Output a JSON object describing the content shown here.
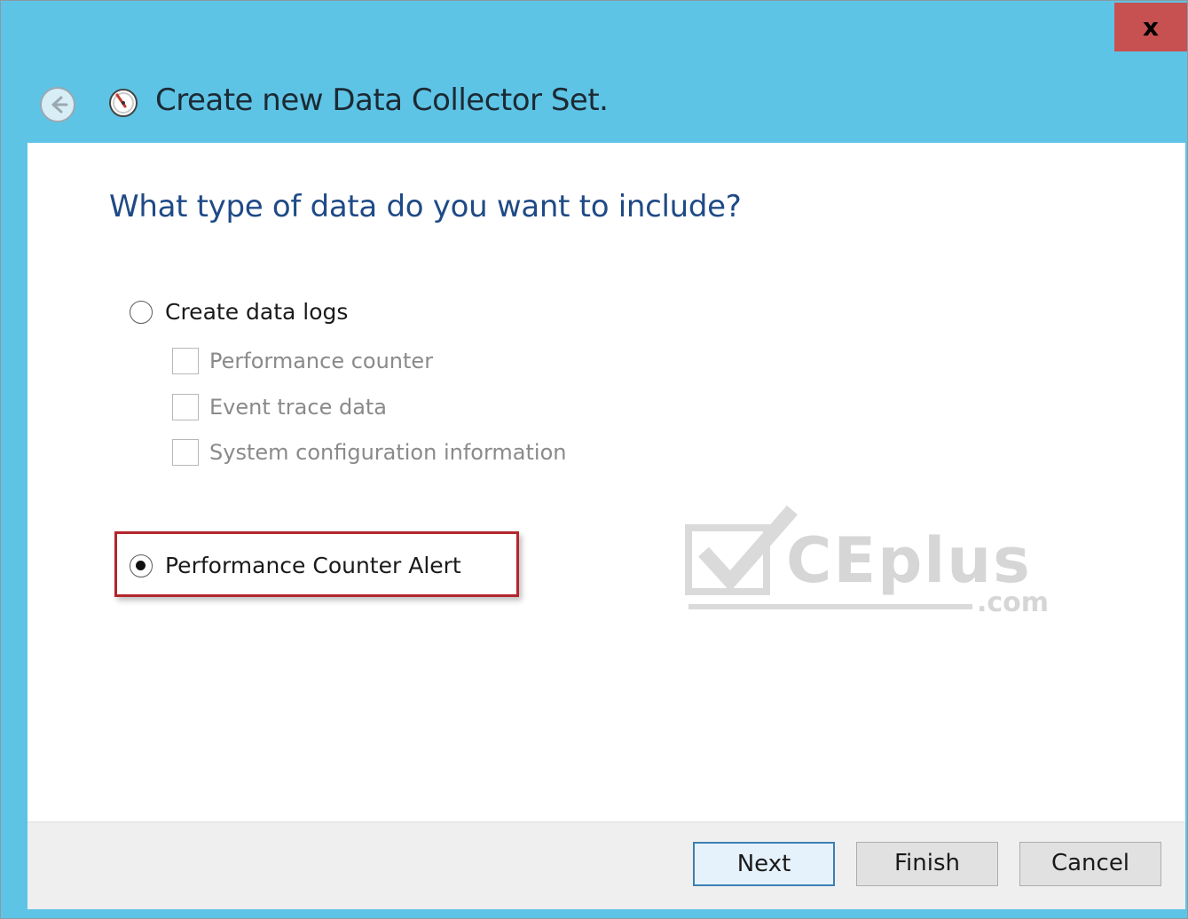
{
  "window": {
    "title": "Create new Data Collector Set.",
    "close_label": "x"
  },
  "page": {
    "question": "What type of data do you want to include?"
  },
  "options": {
    "create_logs": {
      "label": "Create data logs",
      "selected": false,
      "sub_items": [
        {
          "label": "Performance counter",
          "checked": false,
          "enabled": false
        },
        {
          "label": "Event trace data",
          "checked": false,
          "enabled": false
        },
        {
          "label": "System configuration information",
          "checked": false,
          "enabled": false
        }
      ]
    },
    "alert": {
      "label": "Performance Counter Alert",
      "selected": true
    }
  },
  "watermark": {
    "text": "CEplus",
    "suffix": ".com"
  },
  "buttons": {
    "next": "Next",
    "finish": "Finish",
    "cancel": "Cancel"
  },
  "colors": {
    "titlebar": "#5ec4e6",
    "close": "#c75050",
    "heading": "#1f4a86",
    "highlight": "#b3262c"
  }
}
